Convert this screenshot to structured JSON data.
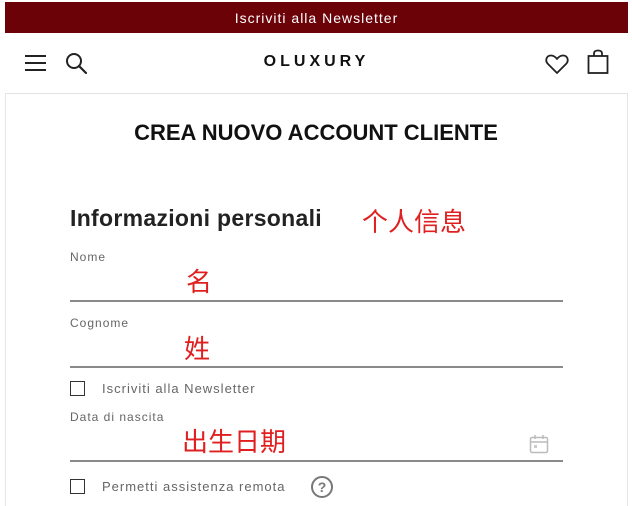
{
  "topbar": {
    "text": "Iscriviti alla Newsletter",
    "bg": "#6a0208"
  },
  "header": {
    "logo": "OLUXURY",
    "icons": [
      "menu-icon",
      "search-icon",
      "heart-icon",
      "bag-icon"
    ]
  },
  "page": {
    "title": "CREA NUOVO ACCOUNT CLIENTE"
  },
  "section": {
    "title": "Informazioni personali",
    "annotation": "个人信息"
  },
  "fields": {
    "nome": {
      "label": "Nome",
      "annotation": "名"
    },
    "cognome": {
      "label": "Cognome",
      "annotation": "姓"
    },
    "newsletter": {
      "label": "Iscriviti alla Newsletter",
      "checked": false
    },
    "data_nascita": {
      "label": "Data di nascita",
      "annotation": "出生日期"
    },
    "assistenza": {
      "label": "Permetti assistenza remota",
      "checked": false,
      "help": "?"
    }
  },
  "colors": {
    "accent": "#6a0208",
    "annotation": "#e02020"
  }
}
